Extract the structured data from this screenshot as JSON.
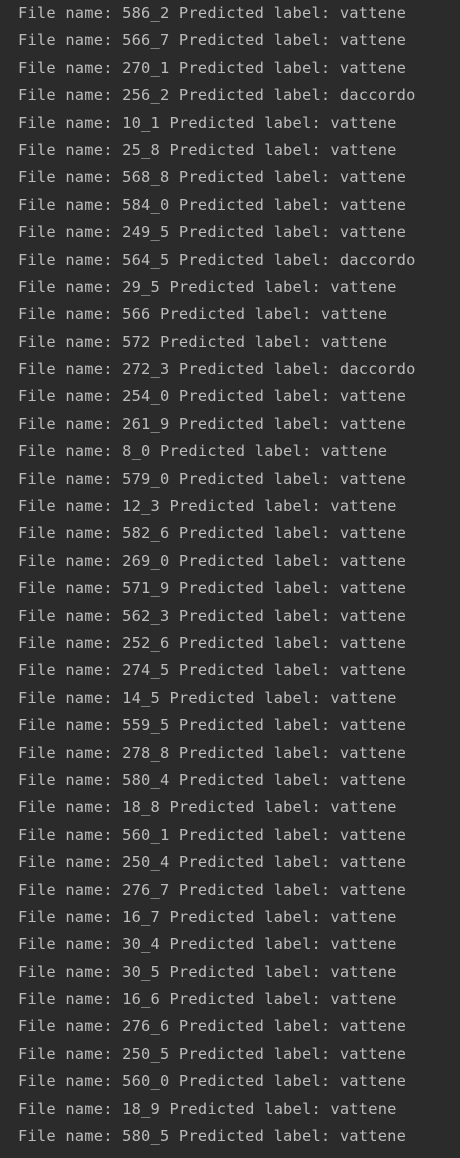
{
  "console": {
    "lines": [
      "File name: 586_2 Predicted label: vattene",
      "File name: 566_7 Predicted label: vattene",
      "File name: 270_1 Predicted label: vattene",
      "File name: 256_2 Predicted label: daccordo",
      "File name: 10_1 Predicted label: vattene",
      "File name: 25_8 Predicted label: vattene",
      "File name: 568_8 Predicted label: vattene",
      "File name: 584_0 Predicted label: vattene",
      "File name: 249_5 Predicted label: vattene",
      "File name: 564_5 Predicted label: daccordo",
      "File name: 29_5 Predicted label: vattene",
      "File name: 566 Predicted label: vattene",
      "File name: 572 Predicted label: vattene",
      "File name: 272_3 Predicted label: daccordo",
      "File name: 254_0 Predicted label: vattene",
      "File name: 261_9 Predicted label: vattene",
      "File name: 8_0 Predicted label: vattene",
      "File name: 579_0 Predicted label: vattene",
      "File name: 12_3 Predicted label: vattene",
      "File name: 582_6 Predicted label: vattene",
      "File name: 269_0 Predicted label: vattene",
      "File name: 571_9 Predicted label: vattene",
      "File name: 562_3 Predicted label: vattene",
      "File name: 252_6 Predicted label: vattene",
      "File name: 274_5 Predicted label: vattene",
      "File name: 14_5 Predicted label: vattene",
      "File name: 559_5 Predicted label: vattene",
      "File name: 278_8 Predicted label: vattene",
      "File name: 580_4 Predicted label: vattene",
      "File name: 18_8 Predicted label: vattene",
      "File name: 560_1 Predicted label: vattene",
      "File name: 250_4 Predicted label: vattene",
      "File name: 276_7 Predicted label: vattene",
      "File name: 16_7 Predicted label: vattene",
      "File name: 30_4 Predicted label: vattene",
      "File name: 30_5 Predicted label: vattene",
      "File name: 16_6 Predicted label: vattene",
      "File name: 276_6 Predicted label: vattene",
      "File name: 250_5 Predicted label: vattene",
      "File name: 560_0 Predicted label: vattene",
      "File name: 18_9 Predicted label: vattene",
      "File name: 580_5 Predicted label: vattene"
    ]
  }
}
